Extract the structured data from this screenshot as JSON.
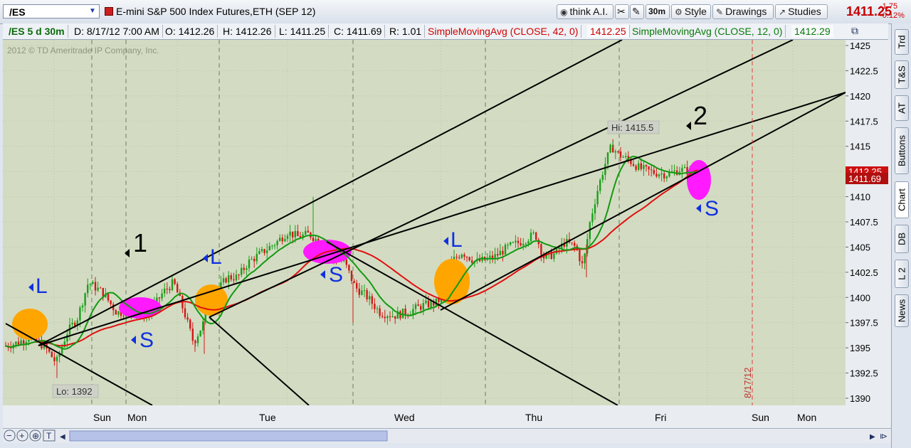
{
  "toolbar": {
    "symbol": "/ES",
    "title": "E-mini S&P 500 Index Futures,ETH (SEP 12)",
    "think_ai": "think A.I.",
    "timeframe": "30m",
    "style": "Style",
    "drawings": "Drawings",
    "studies": "Studies",
    "last_price": "1411.25",
    "change": "-1.75",
    "change_pct": "-0.12%"
  },
  "infobar": {
    "symbol_period": "/ES 5 d 30m",
    "date": "D: 8/17/12 7:00 AM",
    "open": "O: 1412.26",
    "high": "H: 1412.26",
    "low": "L: 1411.25",
    "close": "C: 1411.69",
    "range": "R: 1.01",
    "sma42_label": "SimpleMovingAvg (CLOSE, 42, 0)",
    "sma42_value": "1412.25",
    "sma12_label": "SimpleMovingAvg (CLOSE, 12, 0)",
    "sma12_value": "1412.29"
  },
  "chart": {
    "copyright": "2012 © TD Ameritrade IP Company, Inc.",
    "hi_label": "Hi: 1415.5",
    "lo_label": "Lo: 1392",
    "date_marker": "8/17/12",
    "current_red": "1412.25",
    "current_green": "1411.69",
    "annotation_1": "1",
    "annotation_2": "2",
    "signal_L": "L",
    "signal_S": "S"
  },
  "yaxis": [
    "1425",
    "1422.5",
    "1420",
    "1417.5",
    "1415",
    "1412.5",
    "1410",
    "1407.5",
    "1405",
    "1402.5",
    "1400",
    "1397.5",
    "1395",
    "1392.5",
    "1390"
  ],
  "xaxis": [
    "Sun",
    "Mon",
    "Tue",
    "Wed",
    "Thu",
    "Fri",
    "Sun",
    "Mon"
  ],
  "sidebar": [
    "Trd",
    "T&S",
    "AT",
    "Buttons",
    "Chart",
    "DB",
    "L 2",
    "News"
  ],
  "colors": {
    "sma42": "#e01010",
    "sma12": "#129a12",
    "bg": "#d3dcc2",
    "magenta": "#ff1aff",
    "orange": "#ffa500",
    "signal_blue": "#1030e0"
  }
}
